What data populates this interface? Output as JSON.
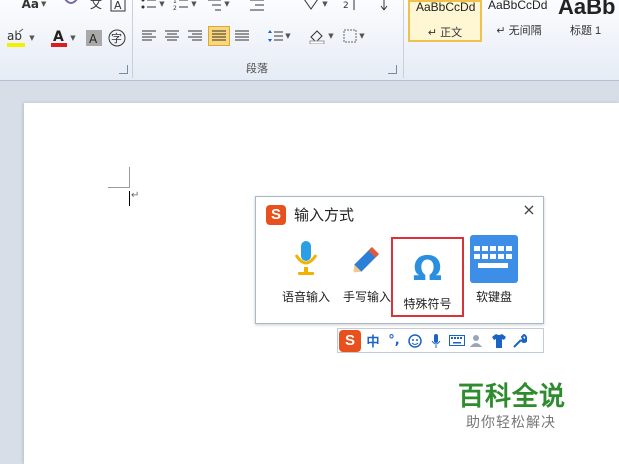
{
  "ribbon": {
    "font_size_label": "Aa",
    "paragraph_group_label": "段落",
    "styles": [
      {
        "sample": "AaBbCcDd",
        "name": "↵ 正文"
      },
      {
        "sample": "AaBbCcDd",
        "name": "↵ 无间隔"
      },
      {
        "sample": "AaBb",
        "name": "标题 1"
      }
    ]
  },
  "document": {
    "paragraph_mark": "↵"
  },
  "ime": {
    "title": "输入方式",
    "close": "×",
    "options": [
      {
        "label": "语音输入"
      },
      {
        "label": "手写输入"
      },
      {
        "label": "特殊符号"
      },
      {
        "label": "软键盘"
      }
    ],
    "statusbar": {
      "mode": "中",
      "punct": "°,"
    }
  },
  "watermark": {
    "title": "百科全说",
    "subtitle": "助你轻松解决"
  },
  "colors": {
    "highlight": "#d9323b",
    "sogou": "#e8501e",
    "watermark_green": "#2e8b2e",
    "keyboard_blue": "#3d8ee6"
  }
}
